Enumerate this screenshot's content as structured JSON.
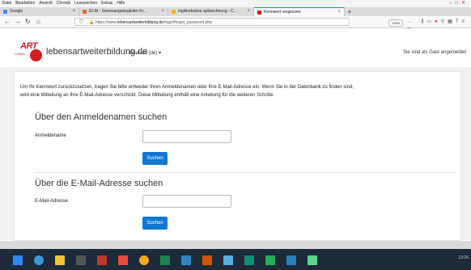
{
  "menubar": {
    "items": [
      "Datei",
      "Bearbeiten",
      "Ansicht",
      "Chronik",
      "Lesezeichen",
      "Extras",
      "Hilfe"
    ]
  },
  "tabs": [
    {
      "label": "Google",
      "color": "#4285f4"
    },
    {
      "label": "EI-IN - Genesungsbegleiter-Kr...",
      "color": "#e66a1f"
    },
    {
      "label": "logikkebutton aufzeichnung - C...",
      "color": "#f4b400"
    },
    {
      "label": "Kennwort vergessen",
      "color": "#d71920",
      "active": true
    }
  ],
  "navbar": {
    "url_prefix": "https://www.",
    "url_domain": "lebensartweiterbildung.de",
    "url_path": "/login/forgot_password.php",
    "zoom": "133%"
  },
  "site": {
    "logo_small": "Lebens",
    "logo_art": "ART",
    "brand_name": "lebensartweiterbildung.de",
    "language": "Deutsch (de)",
    "guest_notice": "Sie sind als Gast angemeldet"
  },
  "page": {
    "intro_line1": "Um Ihr Kennwort zurückzusetzen, tragen Sie bitte entweder Ihren Anmeldenamen oder Ihre E-Mail-Adresse ein. Wenn Sie in der Datenbank zu finden sind,",
    "intro_line2": "wird eine Mitteilung an Ihre E-Mail-Adresse verschickt. Diese Mitteilung enthält eine Anleitung für die weiteren Schritte.",
    "username_section": {
      "heading": "Über den Anmeldenamen suchen",
      "label": "Anmeldename",
      "value": "",
      "button": "Suchen"
    },
    "email_section": {
      "heading": "Über die E-Mail-Adresse suchen",
      "label": "E-Mail-Adresse",
      "value": "",
      "button": "Suchen"
    }
  },
  "taskbar": {
    "clock": "13:26"
  }
}
